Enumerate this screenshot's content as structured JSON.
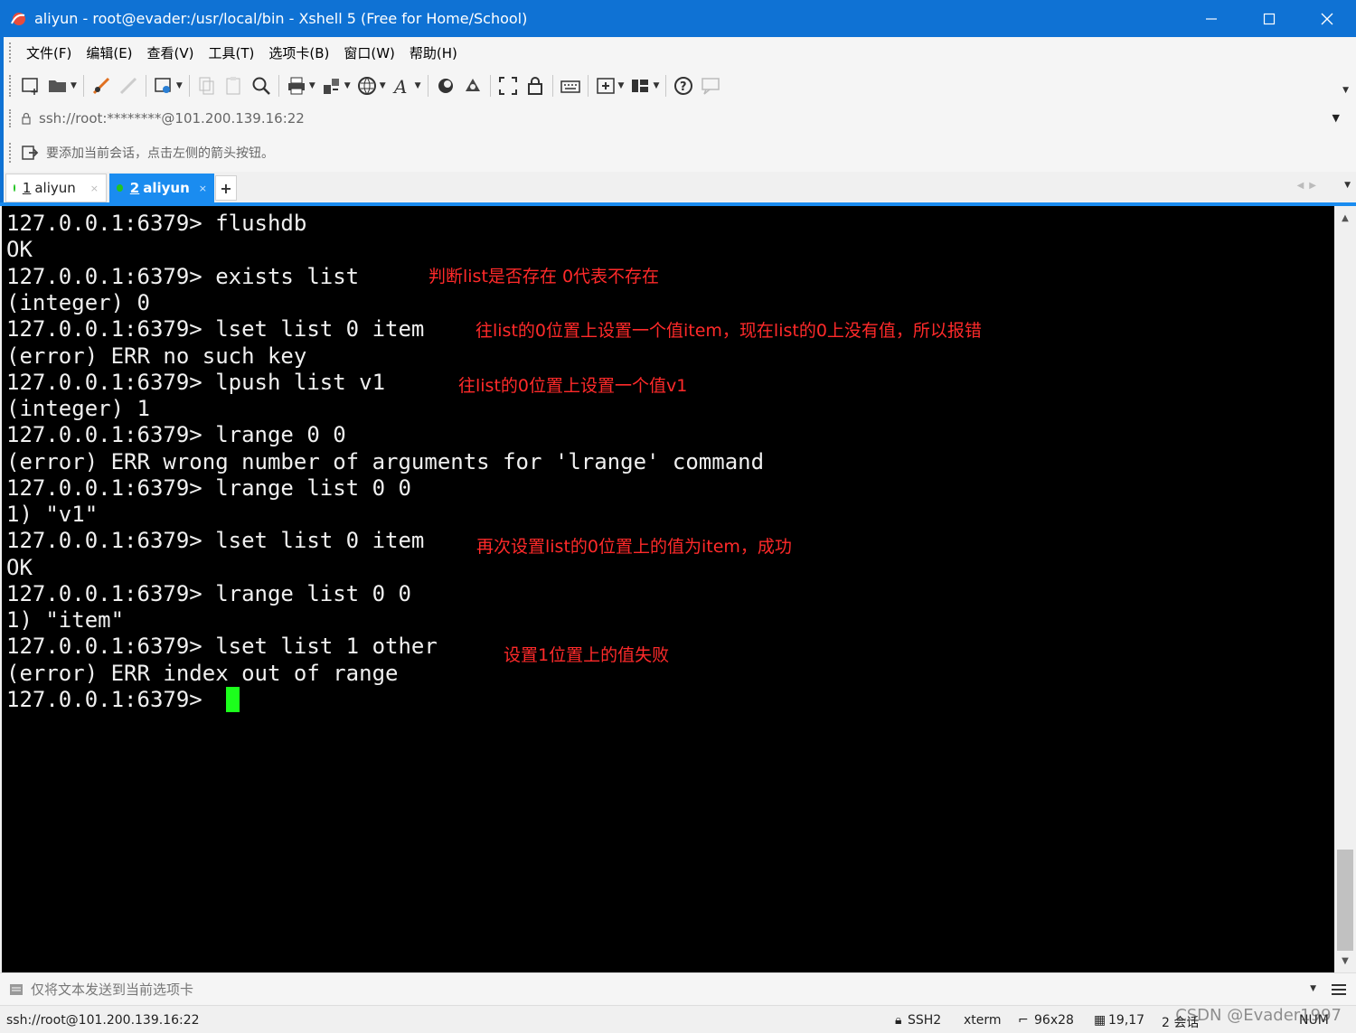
{
  "window": {
    "title": "aliyun - root@evader:/usr/local/bin - Xshell 5 (Free for Home/School)"
  },
  "menu": [
    "文件(F)",
    "编辑(E)",
    "查看(V)",
    "工具(T)",
    "选项卡(B)",
    "窗口(W)",
    "帮助(H)"
  ],
  "address": {
    "text": "ssh://root:********@101.200.139.16:22"
  },
  "hint": {
    "text": "要添加当前会话，点击左侧的箭头按钮。"
  },
  "tabs": [
    {
      "num": "1",
      "label": "aliyun",
      "active": false
    },
    {
      "num": "2",
      "label": "aliyun",
      "active": true
    }
  ],
  "terminal": {
    "lines": [
      "127.0.0.1:6379> flushdb",
      "OK",
      "127.0.0.1:6379> exists list",
      "(integer) 0",
      "127.0.0.1:6379> lset list 0 item",
      "(error) ERR no such key",
      "127.0.0.1:6379> lpush list v1",
      "(integer) 1",
      "127.0.0.1:6379> lrange 0 0",
      "(error) ERR wrong number of arguments for 'lrange' command",
      "127.0.0.1:6379> lrange list 0 0",
      "1) \"v1\"",
      "127.0.0.1:6379> lset list 0 item",
      "OK",
      "127.0.0.1:6379> lrange list 0 0",
      "1) \"item\"",
      "127.0.0.1:6379> lset list 1 other",
      "(error) ERR index out of range",
      "127.0.0.1:6379> "
    ],
    "notes": [
      "判断list是否存在    0代表不存在",
      "往list的0位置上设置一个值item，现在list的0上没有值，所以报错",
      "往list的0位置上设置一个值v1",
      "再次设置list的0位置上的值为item，成功",
      "设置1位置上的值失败"
    ]
  },
  "sendbar": {
    "text": "仅将文本发送到当前选项卡"
  },
  "status": {
    "address": "ssh://root@101.200.139.16:22",
    "protocol": "SSH2",
    "terminal": "xterm",
    "size": "96x28",
    "cursor": "19,17",
    "sessions": "2 会话",
    "num": "NUM"
  },
  "watermark": "CSDN @Evader1997",
  "colors": {
    "titlebar": "#0f72d4",
    "active_tab": "#1a8cf0",
    "annotation": "#ff2a2a",
    "cursor": "#1cff1c",
    "session_dot": "#22c422"
  }
}
